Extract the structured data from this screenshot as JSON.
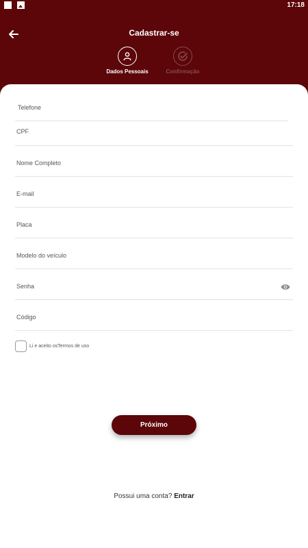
{
  "status_bar": {
    "time": "17:18"
  },
  "header": {
    "title": "Cadastrar-se",
    "back_icon": "arrow-left-icon"
  },
  "steps": [
    {
      "label": "Dados Pessoais",
      "icon": "person-icon",
      "active": true
    },
    {
      "label": "Confirmação",
      "icon": "check-circle-icon",
      "active": false
    }
  ],
  "form": {
    "fields": [
      {
        "label": "Telefone"
      },
      {
        "label": "CPF"
      },
      {
        "label": "Nome Completo"
      },
      {
        "label": "E-mail"
      },
      {
        "label": "Placa"
      },
      {
        "label": "Modelo do veículo"
      },
      {
        "label": "Senha"
      },
      {
        "label": "Código"
      }
    ],
    "terms_text": "Li e aceito osTermos de uso",
    "next_label": "Próximo"
  },
  "footer": {
    "prompt": "Possui uma conta?",
    "login_label": "Entrar"
  },
  "colors": {
    "primary": "#5c060a",
    "inactive": "#8a4a4d",
    "background": "#ffffff"
  }
}
